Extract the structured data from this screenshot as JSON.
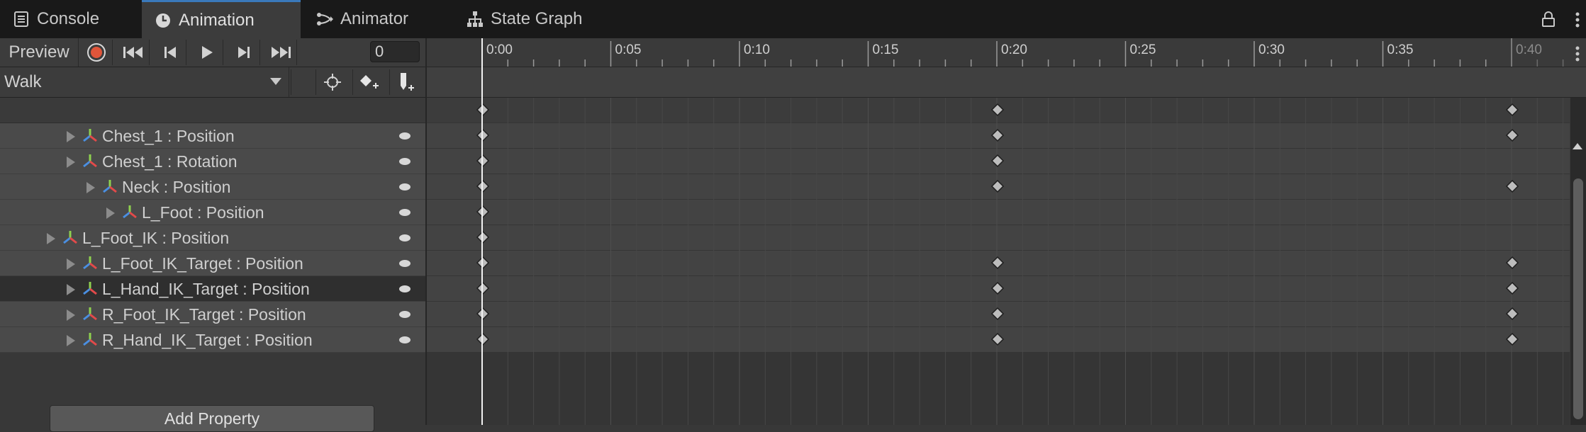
{
  "tabs": [
    {
      "label": "Console",
      "icon": "console-icon",
      "active": false
    },
    {
      "label": "Animation",
      "icon": "animation-clock-icon",
      "active": true
    },
    {
      "label": "Animator",
      "icon": "animator-icon",
      "active": false
    },
    {
      "label": "State Graph",
      "icon": "state-graph-icon",
      "active": false
    }
  ],
  "toolbar": {
    "preview_label": "Preview",
    "frame_value": "0",
    "record_color": "#e0553a"
  },
  "clip": {
    "name": "Walk"
  },
  "properties": [
    {
      "label": "Chest_1 : Position",
      "depth": 1,
      "keys": [
        0,
        20,
        40
      ]
    },
    {
      "label": "Chest_1 : Rotation",
      "depth": 1,
      "keys": [
        0,
        20
      ]
    },
    {
      "label": "Neck : Position",
      "depth": 2,
      "keys": [
        0,
        20,
        40
      ]
    },
    {
      "label": "L_Foot : Position",
      "depth": 3,
      "keys": [
        0
      ]
    },
    {
      "label": "L_Foot_IK : Position",
      "depth": 0,
      "keys": [
        0
      ]
    },
    {
      "label": "L_Foot_IK_Target : Position",
      "depth": 1,
      "keys": [
        0,
        20,
        40
      ]
    },
    {
      "label": "L_Hand_IK_Target : Position",
      "depth": 1,
      "keys": [
        0,
        20,
        40
      ],
      "selected": true
    },
    {
      "label": "R_Foot_IK_Target : Position",
      "depth": 1,
      "keys": [
        0,
        20,
        40
      ]
    },
    {
      "label": "R_Hand_IK_Target : Position",
      "depth": 1,
      "keys": [
        0,
        20,
        40
      ]
    }
  ],
  "summary_keys": [
    0,
    20,
    40
  ],
  "add_property_label": "Add Property",
  "timeline": {
    "major_labels": [
      "0:00",
      "0:05",
      "0:10",
      "0:15",
      "0:20",
      "0:25",
      "0:30",
      "0:35",
      "0:40"
    ],
    "playhead_time": 0,
    "clip_end_time": 40
  },
  "colors": {
    "accent": "#3a79bb",
    "axis_x": "#e24a4a",
    "axis_y": "#8fd14f",
    "axis_z": "#4a8fe2"
  }
}
